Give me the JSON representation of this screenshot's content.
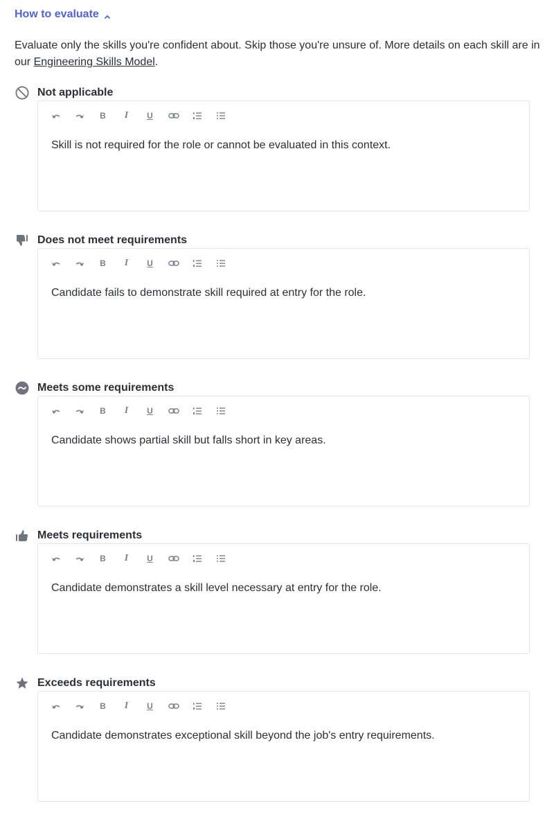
{
  "toggle": {
    "label": "How to evaluate"
  },
  "intro": {
    "text_before": "Evaluate only the skills you're confident about. Skip those you're unsure of. More details on each skill are in our ",
    "link": "Engineering Skills Model",
    "text_after": "."
  },
  "sections": [
    {
      "title": "Not applicable",
      "icon": "not-applicable-icon",
      "content": "Skill is not required for the role or cannot be evaluated in this context."
    },
    {
      "title": "Does not meet requirements",
      "icon": "thumbs-down-icon",
      "content": "Candidate fails to demonstrate skill required at entry for the role."
    },
    {
      "title": "Meets some requirements",
      "icon": "tilde-circle-icon",
      "content": "Candidate shows partial skill but falls short in key areas."
    },
    {
      "title": "Meets requirements",
      "icon": "thumbs-up-icon",
      "content": "Candidate demonstrates a skill level necessary at entry for the role."
    },
    {
      "title": "Exceeds requirements",
      "icon": "star-icon",
      "content": "Candidate demonstrates exceptional skill beyond the job's entry requirements."
    }
  ],
  "toolbar": {
    "bold": "B",
    "italic": "I",
    "underline": "U"
  },
  "colors": {
    "accent": "#4e63d6",
    "icon": "#6e737c",
    "border": "#e3e5e9"
  }
}
